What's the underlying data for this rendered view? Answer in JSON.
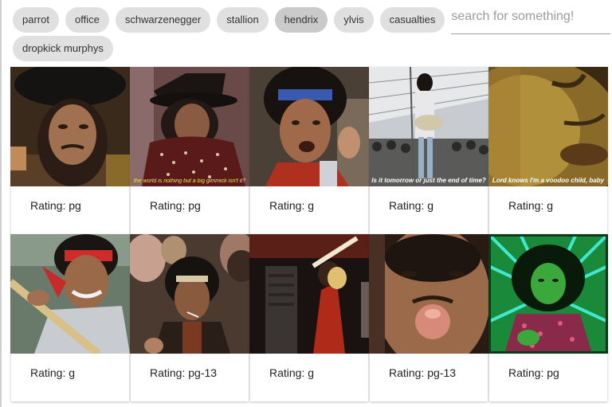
{
  "tags": [
    "parrot",
    "office",
    "schwarzenegger",
    "stallion",
    "hendrix",
    "ylvis",
    "casualties",
    "dropkick murphys"
  ],
  "active_tag": "hendrix",
  "search": {
    "placeholder": "search for something!",
    "value": ""
  },
  "results": [
    {
      "rating": "Rating: pg",
      "caption": ""
    },
    {
      "rating": "Rating: pg",
      "caption": "the world is nothing but a big gimmick isn't it?"
    },
    {
      "rating": "Rating: g",
      "caption": ""
    },
    {
      "rating": "Rating: g",
      "caption": "Is it tomorrow or just the end of time?"
    },
    {
      "rating": "Rating: g",
      "caption": "Lord knows I'm a voodoo child, baby"
    },
    {
      "rating": "Rating: g",
      "caption": ""
    },
    {
      "rating": "Rating: pg-13",
      "caption": ""
    },
    {
      "rating": "Rating: g",
      "caption": ""
    },
    {
      "rating": "Rating: pg-13",
      "caption": ""
    },
    {
      "rating": "Rating: pg",
      "caption": ""
    }
  ],
  "colors": {
    "chip": "#e0e0e0",
    "chip_active": "#cacaca",
    "caption_yellow": "#f3e34a"
  }
}
